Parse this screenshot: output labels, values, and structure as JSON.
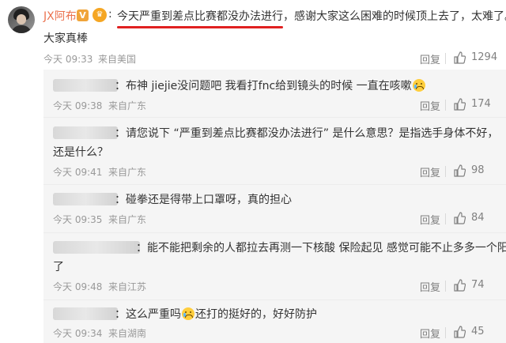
{
  "post": {
    "username": "JX阿布",
    "vip_badge": "V",
    "medal_badge": "♛",
    "colon": ":",
    "text_line1": "今天严重到差点比赛都没办法进行，感谢大家这么困难的时候顶上去了，太难了。",
    "text_line2": "大家真棒",
    "time": "今天 09:33",
    "location": "来自美国",
    "reply_label": "回复",
    "like_count": "1294"
  },
  "replies": [
    {
      "text": "：布神 jiejie没问题吧 我看打fnc给到镜头的时候 一直在咳嗽",
      "emoji_after": true,
      "time": "今天 09:38",
      "location": "来自广东",
      "reply_label": "回复",
      "like_count": "174"
    },
    {
      "text_line1": "：请您说下 “严重到差点比赛都没办法进行” 是什么意思？是指选手身体不好，",
      "text_line2": "还是什么？",
      "time": "今天 09:41",
      "location": "来自广东",
      "reply_label": "回复",
      "like_count": "98"
    },
    {
      "text": "：碰拳还是得带上口罩呀，真的担心",
      "time": "今天 09:35",
      "location": "来自广东",
      "reply_label": "回复",
      "like_count": "84"
    },
    {
      "text_line1": "：能不能把剩余的人都拉去再测一下核酸 保险起见 感觉可能不止多多一个阳",
      "text_line2": "了",
      "time": "今天 09:48",
      "location": "来自江苏",
      "reply_label": "回复",
      "like_count": "74"
    },
    {
      "text_before": "：这么严重吗",
      "text_after": "还打的挺好的，好好防护",
      "time": "今天 09:34",
      "location": "来自湖南",
      "reply_label": "回复",
      "like_count": "45"
    }
  ],
  "colors": {
    "username": "#eb7350",
    "underline": "#e02020",
    "reply_bg": "#f5f5f5",
    "meta": "#999999"
  }
}
